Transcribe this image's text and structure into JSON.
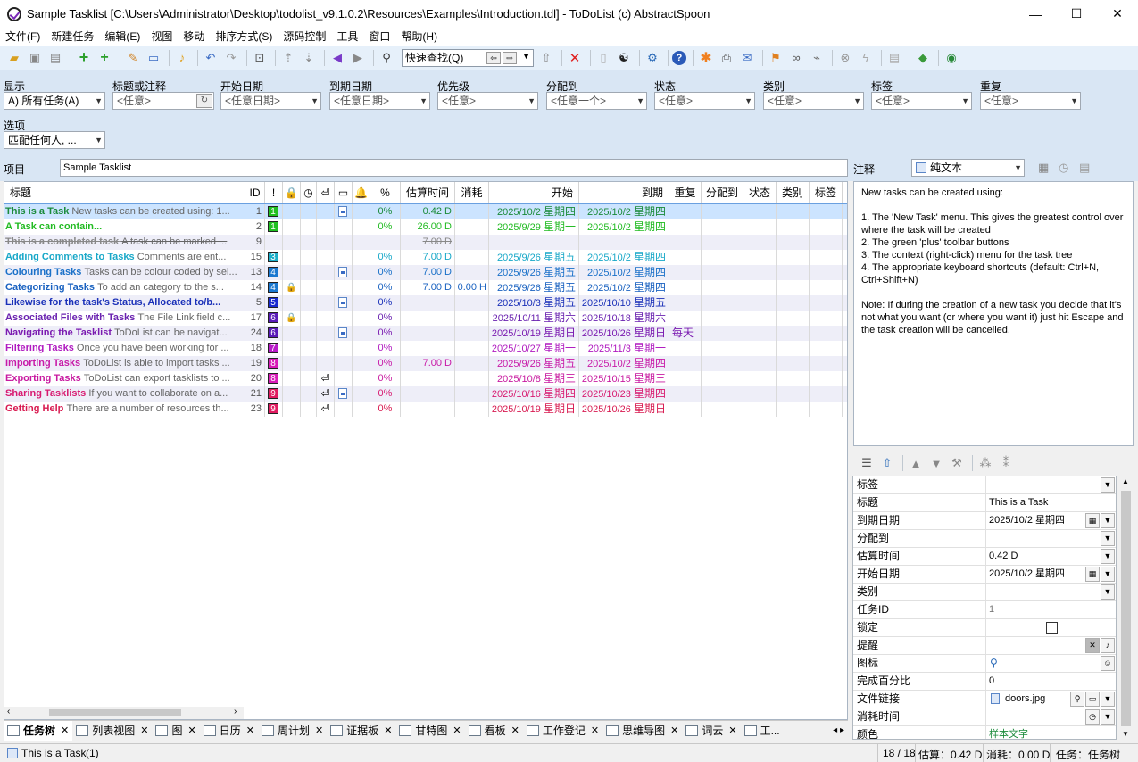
{
  "window": {
    "title": "Sample Tasklist [C:\\Users\\Administrator\\Desktop\\todolist_v9.1.0.2\\Resources\\Examples\\Introduction.tdl] - ToDoList (c) AbstractSpoon",
    "minimize": "—",
    "maximize": "☐",
    "close": "✕"
  },
  "menu": [
    "文件(F)",
    "新建任务",
    "编辑(E)",
    "视图",
    "移动",
    "排序方式(S)",
    "源码控制",
    "工具",
    "窗口",
    "帮助(H)"
  ],
  "toolbar": {
    "quickfind_placeholder": "快速查找(Q)"
  },
  "filters": {
    "show_label": "显示",
    "show_value": "A) 所有任务(A)",
    "title_label": "标题或注释",
    "title_value": "<任意>",
    "start_label": "开始日期",
    "start_value": "<任意日期>",
    "due_label": "到期日期",
    "due_value": "<任意日期>",
    "priority_label": "优先级",
    "priority_value": "<任意>",
    "alloc_label": "分配到",
    "alloc_value": "<任意一个>",
    "status_label": "状态",
    "status_value": "<任意>",
    "category_label": "类别",
    "category_value": "<任意>",
    "tag_label": "标签",
    "tag_value": "<任意>",
    "recur_label": "重复",
    "recur_value": "<任意>",
    "options_label": "选项",
    "options_value": "匹配任何人, ..."
  },
  "project": {
    "label": "项目",
    "value": "Sample Tasklist"
  },
  "notes_header": {
    "label": "注释",
    "format": "纯文本"
  },
  "grid": {
    "headers": {
      "title": "标题",
      "id": "ID",
      "priority": "!",
      "lock": "🔒",
      "clock": "◷",
      "recur": "⏎",
      "file": "▭",
      "remind": "🔔",
      "percent": "%",
      "estimate": "估算时间",
      "spent": "消耗",
      "start": "开始",
      "due": "到期",
      "recurrence": "重复",
      "alloc": "分配到",
      "status": "状态",
      "category": "类别",
      "tags": "标签"
    },
    "rows": [
      {
        "title": "This is a Task",
        "comment": "New tasks can be created using: 1...",
        "id": "1",
        "priority": "1",
        "pcolor": "#20c020",
        "color": "#1a8a3a",
        "lock": "",
        "recur": "",
        "file": true,
        "percent": "0%",
        "estimate": "0.42 D",
        "spent": "",
        "start": "2025/10/2",
        "start_day": "星期四",
        "due": "2025/10/2",
        "due_day": "星期四",
        "recurrence": "",
        "selected": true,
        "done": false
      },
      {
        "title": "A Task can contain...",
        "comment": "",
        "id": "2",
        "priority": "1",
        "pcolor": "#20c020",
        "color": "#22bb22",
        "lock": "",
        "recur": "",
        "file": false,
        "percent": "0%",
        "estimate": "26.00 D",
        "spent": "",
        "start": "2025/9/29",
        "start_day": "星期一",
        "due": "2025/10/2",
        "due_day": "星期四",
        "recurrence": "",
        "selected": false,
        "done": false
      },
      {
        "title": "This is a completed task",
        "comment": "A task can be marked ...",
        "id": "9",
        "priority": "",
        "pcolor": "",
        "color": "#888888",
        "lock": "",
        "recur": "",
        "file": false,
        "percent": "",
        "estimate": "7.00 D",
        "spent": "",
        "start": "",
        "start_day": "",
        "due": "",
        "due_day": "",
        "recurrence": "",
        "selected": false,
        "done": true
      },
      {
        "title": "Adding Comments to Tasks",
        "comment": "Comments are ent...",
        "id": "15",
        "priority": "3",
        "pcolor": "#1aaec8",
        "color": "#18a8c8",
        "lock": "",
        "recur": "",
        "file": false,
        "percent": "0%",
        "estimate": "7.00 D",
        "spent": "",
        "start": "2025/9/26",
        "start_day": "星期五",
        "due": "2025/10/2",
        "due_day": "星期四",
        "recurrence": "",
        "selected": false,
        "done": false
      },
      {
        "title": "Colouring Tasks",
        "comment": "Tasks can be colour coded by sel...",
        "id": "13",
        "priority": "4",
        "pcolor": "#1a78d0",
        "color": "#1a70c8",
        "lock": "",
        "recur": "",
        "file": true,
        "percent": "0%",
        "estimate": "7.00 D",
        "spent": "",
        "start": "2025/9/26",
        "start_day": "星期五",
        "due": "2025/10/2",
        "due_day": "星期四",
        "recurrence": "",
        "selected": false,
        "done": false
      },
      {
        "title": "Categorizing Tasks",
        "comment": "To add an category to the s...",
        "id": "14",
        "priority": "4",
        "pcolor": "#1a78d0",
        "color": "#1a62c0",
        "lock": "🔒",
        "recur": "",
        "file": false,
        "percent": "0%",
        "estimate": "7.00 D",
        "spent": "0.00 H",
        "start": "2025/9/26",
        "start_day": "星期五",
        "due": "2025/10/2",
        "due_day": "星期四",
        "recurrence": "",
        "selected": false,
        "done": false
      },
      {
        "title": "Likewise for the task's Status, Allocated to/b...",
        "comment": "",
        "id": "5",
        "priority": "5",
        "pcolor": "#1a2ad0",
        "color": "#1a30b8",
        "lock": "",
        "recur": "",
        "file": true,
        "percent": "0%",
        "estimate": "",
        "spent": "",
        "start": "2025/10/3",
        "start_day": "星期五",
        "due": "2025/10/10",
        "due_day": "星期五",
        "recurrence": "",
        "selected": false,
        "done": false
      },
      {
        "title": "Associated Files with Tasks",
        "comment": "The File Link field c...",
        "id": "17",
        "priority": "6",
        "pcolor": "#5a1ab8",
        "color": "#6a22b0",
        "lock": "🔒",
        "recur": "",
        "file": false,
        "percent": "0%",
        "estimate": "",
        "spent": "",
        "start": "2025/10/11",
        "start_day": "星期六",
        "due": "2025/10/18",
        "due_day": "星期六",
        "recurrence": "",
        "selected": false,
        "done": false
      },
      {
        "title": "Navigating the Tasklist",
        "comment": "ToDoList can be navigat...",
        "id": "24",
        "priority": "6",
        "pcolor": "#5a1ab8",
        "color": "#7a1ab0",
        "lock": "",
        "recur": "",
        "file": true,
        "percent": "0%",
        "estimate": "",
        "spent": "",
        "start": "2025/10/19",
        "start_day": "星期日",
        "due": "2025/10/26",
        "due_day": "星期日",
        "recurrence": "每天",
        "selected": false,
        "done": false
      },
      {
        "title": "Filtering Tasks",
        "comment": "Once you have been working for ...",
        "id": "18",
        "priority": "7",
        "pcolor": "#b81ac8",
        "color": "#b01ac0",
        "lock": "",
        "recur": "",
        "file": false,
        "percent": "0%",
        "estimate": "",
        "spent": "",
        "start": "2025/10/27",
        "start_day": "星期一",
        "due": "2025/11/3",
        "due_day": "星期一",
        "recurrence": "",
        "selected": false,
        "done": false
      },
      {
        "title": "Importing Tasks",
        "comment": "ToDoList is able to import tasks ...",
        "id": "19",
        "priority": "8",
        "pcolor": "#d81ab8",
        "color": "#c81aa8",
        "lock": "",
        "recur": "",
        "file": false,
        "percent": "0%",
        "estimate": "7.00 D",
        "spent": "",
        "start": "2025/9/26",
        "start_day": "星期五",
        "due": "2025/10/2",
        "due_day": "星期四",
        "recurrence": "",
        "selected": false,
        "done": false
      },
      {
        "title": "Exporting Tasks",
        "comment": "ToDoList can export tasklists to ...",
        "id": "20",
        "priority": "8",
        "pcolor": "#d81ab8",
        "color": "#c81aa0",
        "lock": "",
        "recur": "⏎",
        "file": false,
        "percent": "0%",
        "estimate": "",
        "spent": "",
        "start": "2025/10/8",
        "start_day": "星期三",
        "due": "2025/10/15",
        "due_day": "星期三",
        "recurrence": "",
        "selected": false,
        "done": false
      },
      {
        "title": "Sharing Tasklists",
        "comment": "If you want to collaborate on a...",
        "id": "21",
        "priority": "9",
        "pcolor": "#e01a60",
        "color": "#d81a70",
        "lock": "",
        "recur": "⏎",
        "file": true,
        "percent": "0%",
        "estimate": "",
        "spent": "",
        "start": "2025/10/16",
        "start_day": "星期四",
        "due": "2025/10/23",
        "due_day": "星期四",
        "recurrence": "",
        "selected": false,
        "done": false
      },
      {
        "title": "Getting Help",
        "comment": "There are a number of resources th...",
        "id": "23",
        "priority": "9",
        "pcolor": "#e01a60",
        "color": "#d81a50",
        "lock": "",
        "recur": "⏎",
        "file": false,
        "percent": "0%",
        "estimate": "",
        "spent": "",
        "start": "2025/10/19",
        "start_day": "星期日",
        "due": "2025/10/26",
        "due_day": "星期日",
        "recurrence": "",
        "selected": false,
        "done": false
      }
    ]
  },
  "tabs": [
    "任务树",
    "列表视图",
    "图",
    "日历",
    "周计划",
    "证据板",
    "甘特图",
    "看板",
    "工作登记",
    "思维导图",
    "词云",
    "工..."
  ],
  "notes": {
    "lines": [
      "New tasks can be created using:",
      "",
      "1. The 'New Task' menu. This gives the greatest control over where the task will be created",
      "2. The green 'plus' toolbar buttons",
      "3. The context (right-click) menu for the task tree",
      "4. The appropriate keyboard shortcuts (default: Ctrl+N, Ctrl+Shift+N)",
      "",
      "Note: If during the creation of a new task you decide that it's not what you want (or where you want it) just hit Escape and the task creation will be cancelled."
    ]
  },
  "properties": [
    {
      "k": "标签",
      "v": ""
    },
    {
      "k": "标题",
      "v": "This is a Task"
    },
    {
      "k": "到期日期",
      "v": "2025/10/2 星期四"
    },
    {
      "k": "分配到",
      "v": ""
    },
    {
      "k": "估算时间",
      "v": "0.42 D"
    },
    {
      "k": "开始日期",
      "v": "2025/10/2 星期四"
    },
    {
      "k": "类别",
      "v": ""
    },
    {
      "k": "任务ID",
      "v": "1"
    },
    {
      "k": "锁定",
      "v": ""
    },
    {
      "k": "提醒",
      "v": ""
    },
    {
      "k": "图标",
      "v": ""
    },
    {
      "k": "完成百分比",
      "v": "0"
    },
    {
      "k": "文件链接",
      "v": "doors.jpg"
    },
    {
      "k": "消耗时间",
      "v": ""
    },
    {
      "k": "颜色",
      "v": "样本文字"
    }
  ],
  "status": {
    "task": "This is a Task",
    "count": "(1)",
    "tasks": "18 / 18",
    "estimate": "估算：0.42 D",
    "spent": "消耗：0.00 D",
    "view": "任务：任务树"
  },
  "colors": {
    "selected_row": "#cce4ff",
    "alt_row": "#eeeef8",
    "filterbar": "#d9e6f4"
  }
}
